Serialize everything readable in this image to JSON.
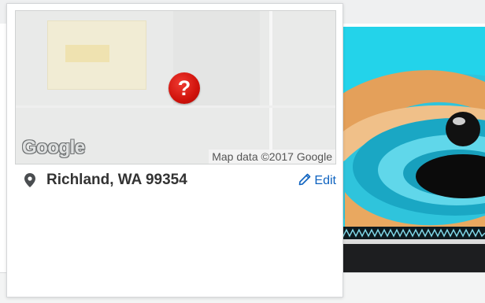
{
  "map": {
    "provider_logo": "Google",
    "attribution": "Map data ©2017 Google",
    "error_symbol": "?"
  },
  "location": {
    "text": "Richland, WA 99354",
    "icon": "map-pin-icon"
  },
  "edit": {
    "label": "Edit",
    "icon": "pencil-icon"
  },
  "colors": {
    "link": "#0e63c0",
    "error": "#d0120b",
    "thumbnail_bg": "#23d3ea"
  }
}
